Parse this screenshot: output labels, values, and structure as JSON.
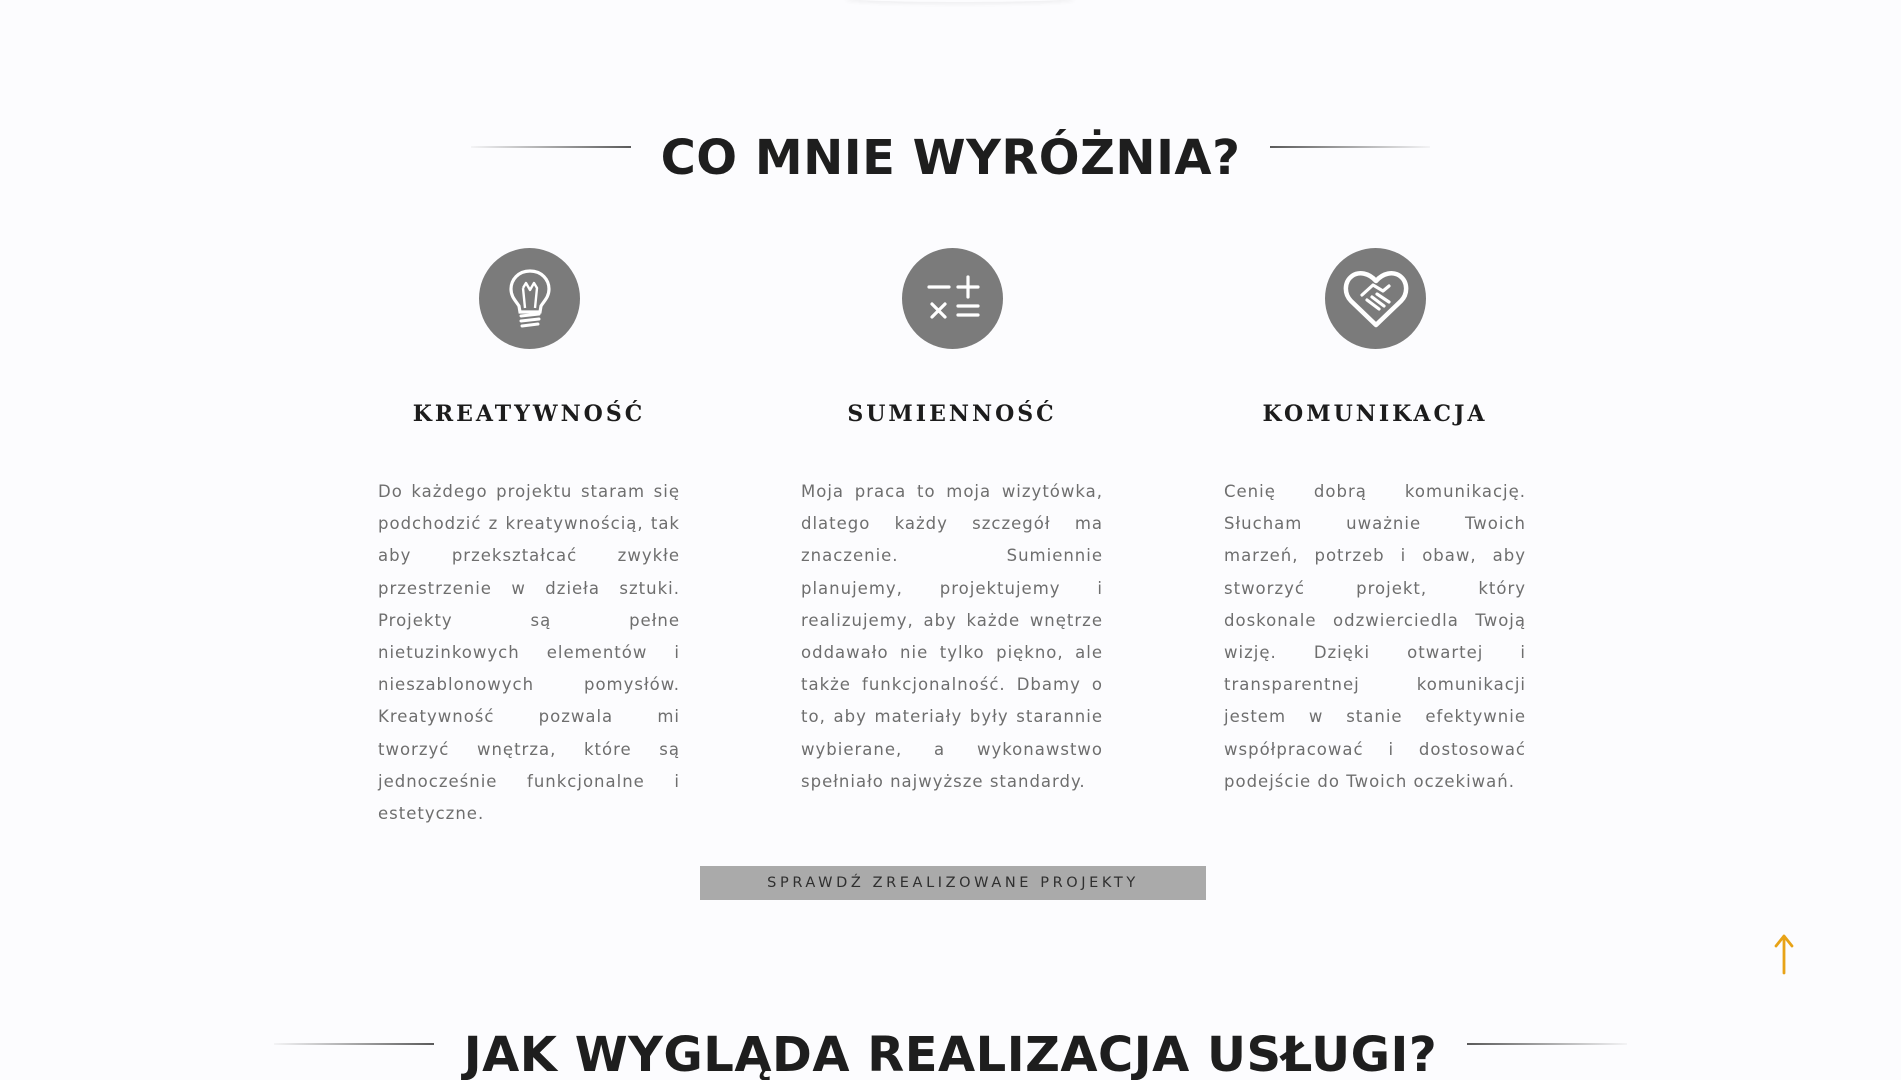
{
  "section_1": {
    "heading": "CO MNIE WYRÓŻNIA?"
  },
  "features": [
    {
      "icon": "lightbulb-icon",
      "title": "KREATYWNOŚĆ",
      "text": "Do każdego projektu staram się podchodzić z kreatywnością, tak aby przekształcać zwykłe przestrzenie w dzieła sztuki. Projekty są pełne nietuzinkowych elementów i nieszablonowych pomysłów. Kreatywność pozwala mi tworzyć wnętrza, które są jednocześnie funkcjonalne i estetyczne."
    },
    {
      "icon": "calculator-icon",
      "title": "SUMIENNOŚĆ",
      "text": "Moja praca to moja wizytówka, dlatego każdy szczegół ma znaczenie. Sumiennie planujemy, projektujemy i realizujemy, aby każde wnętrze oddawało nie tylko piękno, ale także funkcjonalność. Dbamy o to, aby materiały były starannie wybierane, a wykonawstwo spełniało najwyższe standardy."
    },
    {
      "icon": "heart-handshake-icon",
      "title": "KOMUNIKACJA",
      "text": "Cenię dobrą komunikację. Słucham uważnie Twoich marzeń, potrzeb i obaw, aby stworzyć projekt, który doskonale odzwierciedla Twoją wizję. Dzięki otwartej i transparentnej komunikacji jestem w stanie efektywnie współpracować i dostosować podejście do Twoich oczekiwań."
    }
  ],
  "cta": {
    "label": "SPRAWDŹ ZREALIZOWANE PROJEKTY"
  },
  "section_2": {
    "heading": "JAK WYGLĄDA REALIZACJA USŁUGI?"
  },
  "scroll_top": {
    "icon": "arrow-up-icon",
    "color": "#e8a317"
  },
  "colors": {
    "icon_circle": "#7b7b7b",
    "button_bg": "#aaaaaa",
    "body_text": "#6e6e6e",
    "heading": "#1e1e1e"
  }
}
